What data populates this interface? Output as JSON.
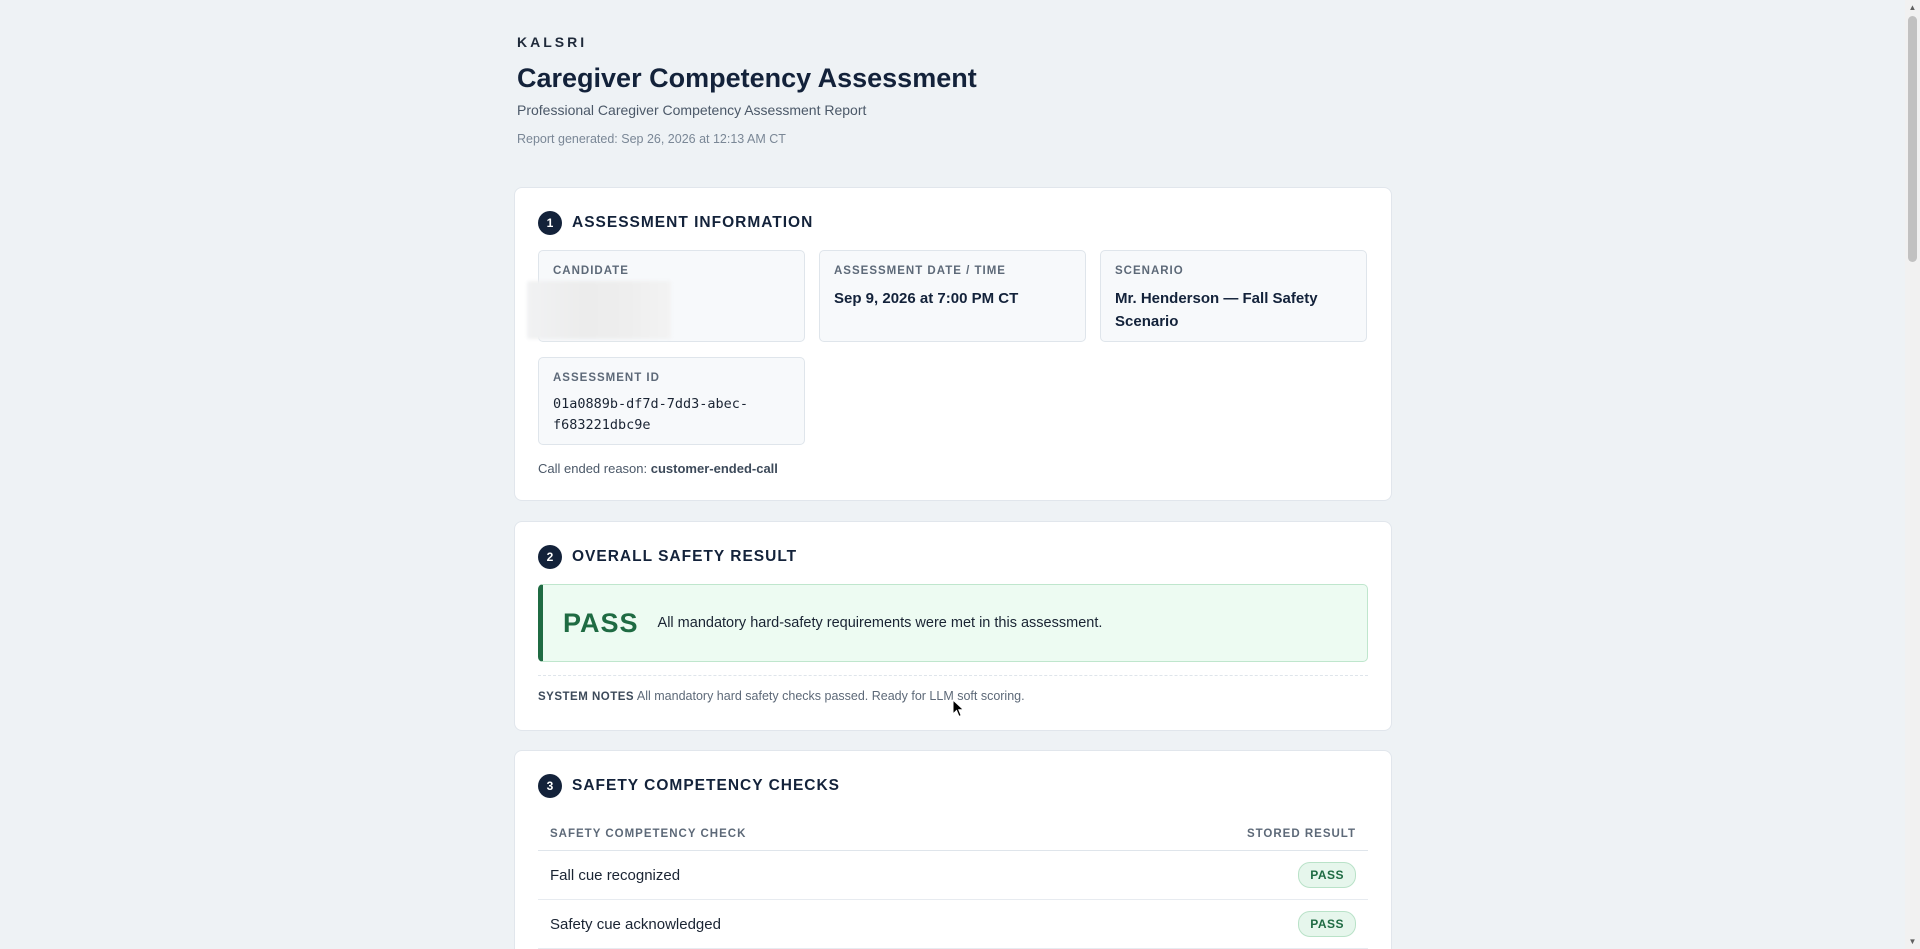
{
  "header": {
    "brand": "KALSRI",
    "title": "Caregiver Competency Assessment",
    "subtitle": "Professional Caregiver Competency Assessment Report",
    "generated": "Report generated: Sep 26, 2026 at 12:13 AM CT"
  },
  "section1": {
    "number": "1",
    "title": "ASSESSMENT INFORMATION",
    "candidate_label": "CANDIDATE",
    "date_label": "ASSESSMENT DATE / TIME",
    "date_value": "Sep 9, 2026 at 7:00 PM CT",
    "scenario_label": "SCENARIO",
    "scenario_value": "Mr. Henderson — Fall Safety Scenario",
    "id_label": "ASSESSMENT ID",
    "id_value": "01a0889b-df7d-7dd3-abec-f683221dbc9e",
    "call_ended_label": "Call ended reason:",
    "call_ended_value": "customer-ended-call"
  },
  "section2": {
    "number": "2",
    "title": "OVERALL SAFETY RESULT",
    "status": "PASS",
    "message": "All mandatory hard-safety requirements were met in this assessment.",
    "notes_label": "SYSTEM NOTES",
    "notes_text": "All mandatory hard safety checks passed. Ready for LLM soft scoring."
  },
  "section3": {
    "number": "3",
    "title": "SAFETY COMPETENCY CHECKS",
    "col_check": "SAFETY COMPETENCY CHECK",
    "col_result": "STORED RESULT",
    "rows": [
      {
        "label": "Fall cue recognized",
        "result": "PASS"
      },
      {
        "label": "Safety cue acknowledged",
        "result": "PASS"
      }
    ]
  },
  "colors": {
    "navy": "#13223a",
    "pass_green": "#1f6b43",
    "pass_bg": "#edfbf2",
    "page_bg": "#eef2f5"
  }
}
